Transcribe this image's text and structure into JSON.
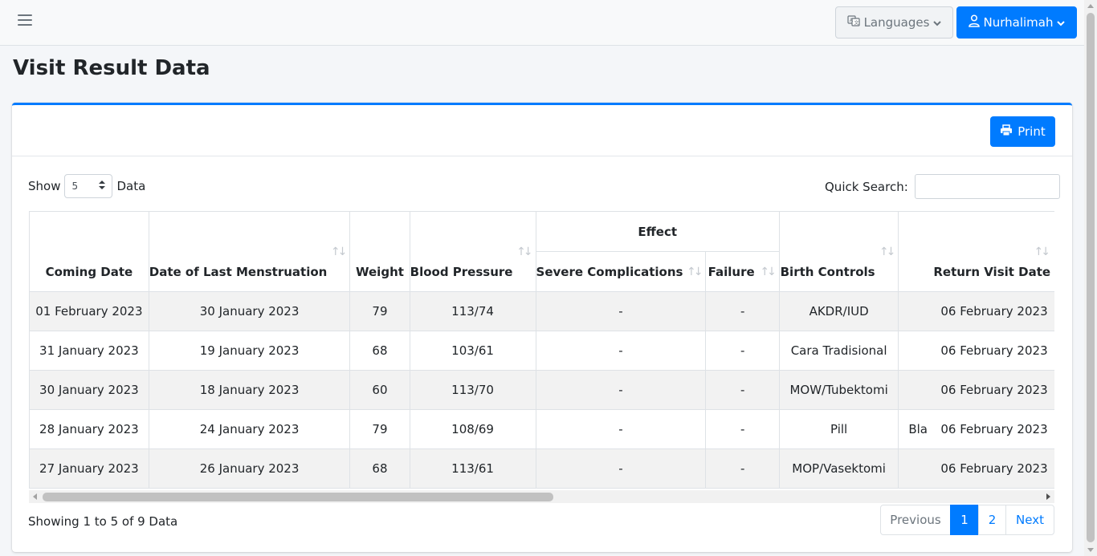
{
  "topbar": {
    "languages_label": "Languages",
    "user_label": "Nurhalimah"
  },
  "page": {
    "title": "Visit Result Data"
  },
  "card": {
    "print_label": "Print"
  },
  "controls": {
    "show_label": "Show",
    "show_value": "5",
    "data_label": "Data",
    "search_label": "Quick Search:",
    "search_value": ""
  },
  "table": {
    "group_header": "Effect",
    "columns": {
      "coming_date": "Coming Date",
      "last_menstruation": "Date of Last Menstruation",
      "weight": "Weight",
      "blood_pressure": "Blood Pressure",
      "severe_complications": "Severe Complications",
      "failure": "Failure",
      "birth_controls": "Birth Controls",
      "return_visit_date": "Return Visit Date"
    },
    "rows": [
      {
        "coming": "01 February 2023",
        "lmp": "30 January 2023",
        "weight": "79",
        "bp": "113/74",
        "severe": "-",
        "failure": "-",
        "birth": "AKDR/IUD",
        "ghost": "",
        "return": "06 February 2023"
      },
      {
        "coming": "31 January 2023",
        "lmp": "19 January 2023",
        "weight": "68",
        "bp": "103/61",
        "severe": "-",
        "failure": "-",
        "birth": "Cara Tradisional",
        "ghost": "",
        "return": "06 February 2023"
      },
      {
        "coming": "30 January 2023",
        "lmp": "18 January 2023",
        "weight": "60",
        "bp": "113/70",
        "severe": "-",
        "failure": "-",
        "birth": "MOW/Tubektomi",
        "ghost": "",
        "return": "06 February 2023"
      },
      {
        "coming": "28 January 2023",
        "lmp": "24 January 2023",
        "weight": "79",
        "bp": "108/69",
        "severe": "-",
        "failure": "-",
        "birth": "Pill",
        "ghost": "Bla",
        "return": "06 February 2023"
      },
      {
        "coming": "27 January 2023",
        "lmp": "26 January 2023",
        "weight": "68",
        "bp": "113/61",
        "severe": "-",
        "failure": "-",
        "birth": "MOP/Vasektomi",
        "ghost": "",
        "return": "06 February 2023"
      }
    ]
  },
  "footer": {
    "info": "Showing 1 to 5 of 9 Data",
    "prev_label": "Previous",
    "page1": "1",
    "page2": "2",
    "next_label": "Next"
  }
}
